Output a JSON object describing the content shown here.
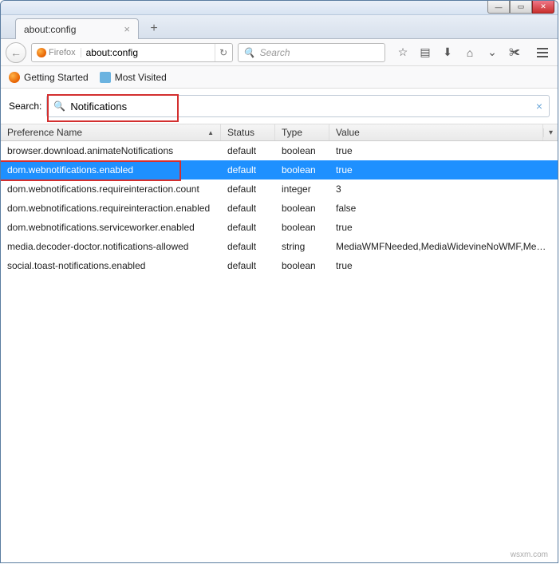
{
  "window": {
    "tab_title": "about:config"
  },
  "nav": {
    "identity": "Firefox",
    "url": "about:config",
    "search_placeholder": "Search"
  },
  "bookmarks": {
    "item1": "Getting Started",
    "item2": "Most Visited"
  },
  "search": {
    "label": "Search:",
    "value": "Notifications"
  },
  "columns": {
    "name": "Preference Name",
    "status": "Status",
    "type": "Type",
    "value": "Value"
  },
  "rows": [
    {
      "name": "browser.download.animateNotifications",
      "status": "default",
      "type": "boolean",
      "value": "true",
      "selected": false
    },
    {
      "name": "dom.webnotifications.enabled",
      "status": "default",
      "type": "boolean",
      "value": "true",
      "selected": true
    },
    {
      "name": "dom.webnotifications.requireinteraction.count",
      "status": "default",
      "type": "integer",
      "value": "3",
      "selected": false
    },
    {
      "name": "dom.webnotifications.requireinteraction.enabled",
      "status": "default",
      "type": "boolean",
      "value": "false",
      "selected": false
    },
    {
      "name": "dom.webnotifications.serviceworker.enabled",
      "status": "default",
      "type": "boolean",
      "value": "true",
      "selected": false
    },
    {
      "name": "media.decoder-doctor.notifications-allowed",
      "status": "default",
      "type": "string",
      "value": "MediaWMFNeeded,MediaWidevineNoWMF,Media...",
      "selected": false
    },
    {
      "name": "social.toast-notifications.enabled",
      "status": "default",
      "type": "boolean",
      "value": "true",
      "selected": false
    }
  ],
  "watermark": "wsxm.com"
}
